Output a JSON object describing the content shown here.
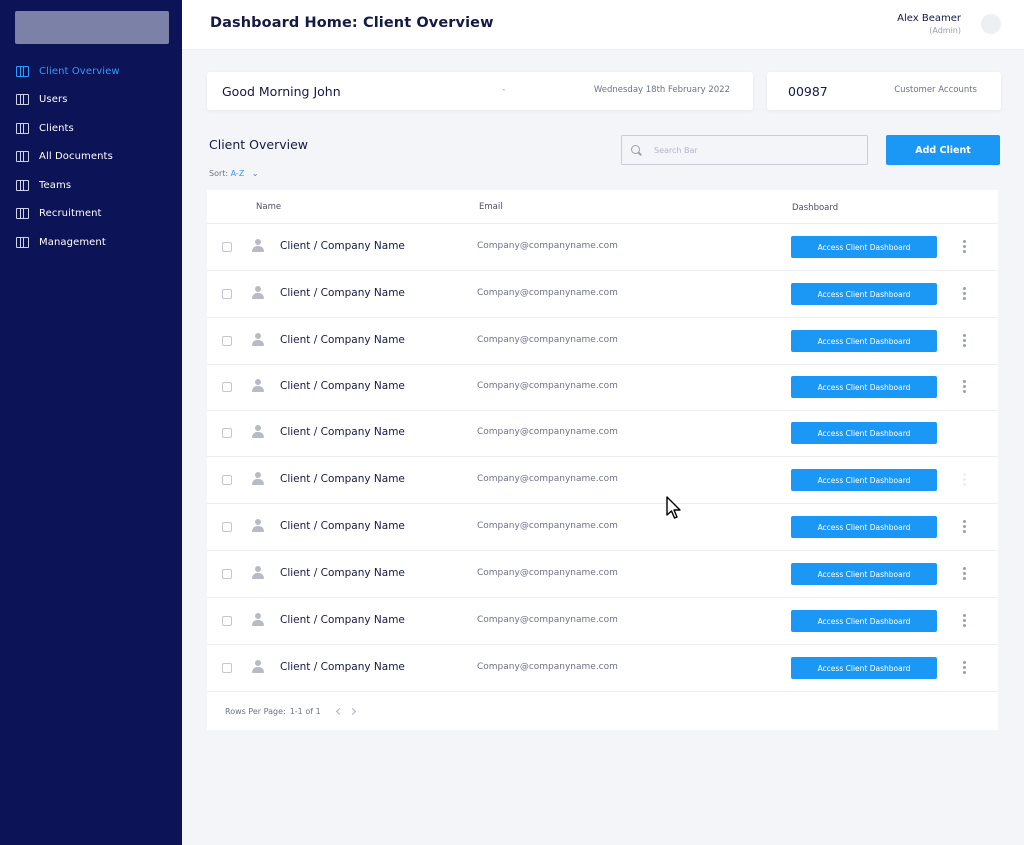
{
  "sidebar": {
    "items": [
      {
        "label": "Client Overview",
        "active": true
      },
      {
        "label": "Users"
      },
      {
        "label": "Clients"
      },
      {
        "label": "All Documents"
      },
      {
        "label": "Teams"
      },
      {
        "label": "Recruitment"
      },
      {
        "label": "Management"
      }
    ]
  },
  "header": {
    "title": "Dashboard Home: Client Overview",
    "user_name": "Alex Beamer",
    "user_role": "(Admin)"
  },
  "greeting": {
    "text": "Good Morning John",
    "separator": "-",
    "date": "Wednesday 18th February 2022"
  },
  "accounts": {
    "count": "00987",
    "label": "Customer Accounts"
  },
  "toolbar": {
    "section_title": "Client Overview",
    "sort_label": "Sort:",
    "sort_value": "A-Z",
    "search_placeholder": "Search Bar",
    "add_label": "Add Client"
  },
  "table": {
    "headers": {
      "name": "Name",
      "email": "Email",
      "dashboard": "Dashboard"
    },
    "rows": [
      {
        "name": "Client / Company Name",
        "email": "Company@companyname.com",
        "action": "Access Client Dashboard"
      },
      {
        "name": "Client / Company Name",
        "email": "Company@companyname.com",
        "action": "Access Client Dashboard"
      },
      {
        "name": "Client / Company Name",
        "email": "Company@companyname.com",
        "action": "Access Client Dashboard"
      },
      {
        "name": "Client / Company Name",
        "email": "Company@companyname.com",
        "action": "Access Client Dashboard"
      },
      {
        "name": "Client / Company Name",
        "email": "Company@companyname.com",
        "action": "Access Client Dashboard"
      },
      {
        "name": "Client / Company Name",
        "email": "Company@companyname.com",
        "action": "Access Client Dashboard"
      },
      {
        "name": "Client / Company Name",
        "email": "Company@companyname.com",
        "action": "Access Client Dashboard"
      },
      {
        "name": "Client / Company Name",
        "email": "Company@companyname.com",
        "action": "Access Client Dashboard"
      },
      {
        "name": "Client / Company Name",
        "email": "Company@companyname.com",
        "action": "Access Client Dashboard"
      },
      {
        "name": "Client / Company Name",
        "email": "Company@companyname.com",
        "action": "Access Client Dashboard"
      }
    ],
    "footer": {
      "rows_per_page_label": "Rows Per Page:",
      "rows_per_page_value": "1-1 of 1"
    }
  },
  "colors": {
    "sidebar_bg": "#0c1356",
    "accent": "#1b98f5",
    "active_nav": "#2f9bff",
    "page_bg": "#f4f5f8"
  },
  "icons": [
    "table-icon",
    "search-icon",
    "person-icon",
    "more-vertical-icon",
    "chevron-left-icon",
    "chevron-right-icon",
    "pointer-cursor-icon"
  ]
}
